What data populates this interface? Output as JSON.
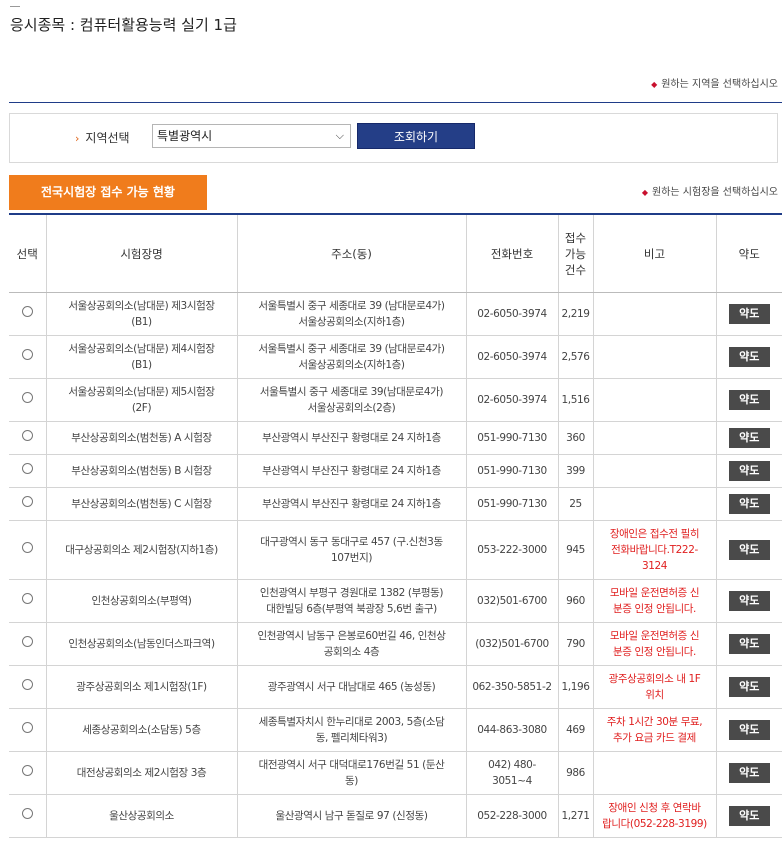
{
  "page": {
    "title": "응시종목 : 컴퓨터활용능력 실기 1급",
    "hint_region": "원하는 지역을 선택하십시오",
    "hint_site": "원하는 시험장을 선택하십시오"
  },
  "region": {
    "label": "지역선택",
    "selected": "특별광역시",
    "search_button": "조회하기"
  },
  "status_tab": "전국시험장 접수 가능 현황",
  "table": {
    "headers": {
      "select": "선택",
      "name": "시험장명",
      "address": "주소(동)",
      "phone": "전화번호",
      "count": "접수\n가능\n건수",
      "note": "비고",
      "map": "약도"
    },
    "map_label": "약도",
    "rows": [
      {
        "name": "서울상공회의소(남대문) 제3시험장\n(B1)",
        "address": "서울특별시 중구 세종대로 39 (남대문로4가)\n서울상공회의소(지하1층)",
        "phone": "02-6050-3974",
        "count": "2,219",
        "note": ""
      },
      {
        "name": "서울상공회의소(남대문) 제4시험장\n(B1)",
        "address": "서울특별시 중구 세종대로 39 (남대문로4가)\n서울상공회의소(지하1층)",
        "phone": "02-6050-3974",
        "count": "2,576",
        "note": ""
      },
      {
        "name": "서울상공회의소(남대문) 제5시험장\n(2F)",
        "address": "서울특별시 중구 세종대로 39(남대문로4가)\n서울상공회의소(2층)",
        "phone": "02-6050-3974",
        "count": "1,516",
        "note": ""
      },
      {
        "name": "부산상공회의소(범천동) A 시험장",
        "address": "부산광역시 부산진구 황령대로 24 지하1층",
        "phone": "051-990-7130",
        "count": "360",
        "note": ""
      },
      {
        "name": "부산상공회의소(범천동) B 시험장",
        "address": "부산광역시 부산진구 황령대로 24 지하1층",
        "phone": "051-990-7130",
        "count": "399",
        "note": ""
      },
      {
        "name": "부산상공회의소(범천동) C 시험장",
        "address": "부산광역시 부산진구 황령대로 24 지하1층",
        "phone": "051-990-7130",
        "count": "25",
        "note": ""
      },
      {
        "name": "대구상공회의소 제2시험장(지하1층)",
        "address": "대구광역시 동구 동대구로 457 (구.신천3동\n107번지)",
        "phone": "053-222-3000",
        "count": "945",
        "note": "장애인은 접수전 필히\n전화바랍니다.T222-\n3124"
      },
      {
        "name": "인천상공회의소(부평역)",
        "address": "인천광역시 부평구 경원대로 1382 (부평동)\n대한빌딩 6층(부평역 북광장 5,6번 출구)",
        "phone": "032)501-6700",
        "count": "960",
        "note": "모바일 운전면허증 신\n분증 인정 안됩니다."
      },
      {
        "name": "인천상공회의소(남동인더스파크역)",
        "address": "인천광역시 남동구 은봉로60번길 46, 인천상\n공회의소 4층",
        "phone": "(032)501-6700",
        "count": "790",
        "note": "모바일 운전면허증 신\n분증 인정 안됩니다."
      },
      {
        "name": "광주상공회의소 제1시험장(1F)",
        "address": "광주광역시 서구 대남대로 465 (농성동)",
        "phone": "062-350-5851-2",
        "count": "1,196",
        "note": "광주상공회의소 내 1F\n위치"
      },
      {
        "name": "세종상공회의소(소담동) 5층",
        "address": "세종특별자치시 한누리대로 2003, 5층(소담\n동, 펠리체타워3)",
        "phone": "044-863-3080",
        "count": "469",
        "note": "주차 1시간 30분 무료,\n추가 요금 카드 결제"
      },
      {
        "name": "대전상공회의소 제2시험장 3층",
        "address": "대전광역시 서구 대덕대로176번길 51 (둔산\n동)",
        "phone": "042) 480-3051~4",
        "count": "986",
        "note": ""
      },
      {
        "name": "울산상공회의소",
        "address": "울산광역시 남구 돋질로 97 (신정동)",
        "phone": "052-228-3000",
        "count": "1,271",
        "note": "장애인 신청 후 연락바\n랍니다(052-228-3199)"
      }
    ]
  }
}
